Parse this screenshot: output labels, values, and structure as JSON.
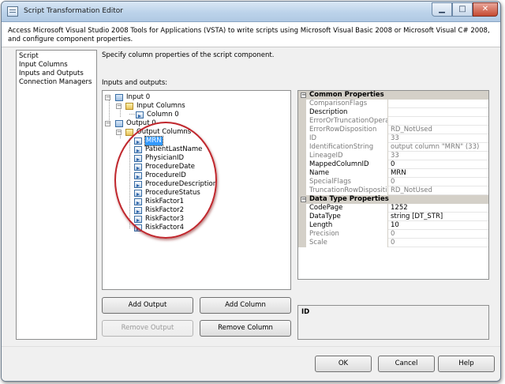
{
  "window": {
    "title": "Script Transformation Editor",
    "min_glyph": "▁",
    "max_glyph": "□",
    "close_glyph": "✕"
  },
  "header": {
    "description": "Access Microsoft Visual Studio 2008 Tools for Applications (VSTA) to write scripts using Microsoft Visual Basic 2008 or Microsoft Visual C# 2008, and configure component properties."
  },
  "nav": {
    "items": [
      "Script",
      "Input Columns",
      "Inputs and Outputs",
      "Connection Managers"
    ]
  },
  "main": {
    "instruction": "Specify column properties of the script component.",
    "io_label": "Inputs and outputs:"
  },
  "tree": {
    "input": "Input 0",
    "input_columns": "Input Columns",
    "input_column_items": [
      "Column 0"
    ],
    "output": "Output 0",
    "output_columns": "Output Columns",
    "output_column_items": [
      "MRN",
      "PatientLastName",
      "PhysicianID",
      "ProcedureDate",
      "ProcedureID",
      "ProcedureDescription",
      "ProcedureStatus",
      "RiskFactor1",
      "RiskFactor2",
      "RiskFactor3",
      "RiskFactor4"
    ],
    "selected": "MRN"
  },
  "buttons": {
    "add_output": "Add Output",
    "add_column": "Add Column",
    "remove_output": "Remove Output",
    "remove_column": "Remove Column",
    "ok": "OK",
    "cancel": "Cancel",
    "help": "Help"
  },
  "properties": {
    "common_title": "Common Properties",
    "common": [
      {
        "name": "ComparisonFlags",
        "value": "",
        "readonly": true
      },
      {
        "name": "Description",
        "value": "",
        "readonly": false
      },
      {
        "name": "ErrorOrTruncationOperatio",
        "value": "",
        "readonly": true
      },
      {
        "name": "ErrorRowDisposition",
        "value": "RD_NotUsed",
        "readonly": true
      },
      {
        "name": "ID",
        "value": "33",
        "readonly": true
      },
      {
        "name": "IdentificationString",
        "value": "output column \"MRN\" (33)",
        "readonly": true
      },
      {
        "name": "LineageID",
        "value": "33",
        "readonly": true
      },
      {
        "name": "MappedColumnID",
        "value": "0",
        "readonly": false
      },
      {
        "name": "Name",
        "value": "MRN",
        "readonly": false
      },
      {
        "name": "SpecialFlags",
        "value": "0",
        "readonly": true
      },
      {
        "name": "TruncationRowDisposition",
        "value": "RD_NotUsed",
        "readonly": true
      }
    ],
    "datatype_title": "Data Type Properties",
    "datatype": [
      {
        "name": "CodePage",
        "value": "1252",
        "readonly": false
      },
      {
        "name": "DataType",
        "value": "string [DT_STR]",
        "readonly": false
      },
      {
        "name": "Length",
        "value": "10",
        "readonly": false
      },
      {
        "name": "Precision",
        "value": "0",
        "readonly": true
      },
      {
        "name": "Scale",
        "value": "0",
        "readonly": true
      }
    ],
    "description_title": "ID"
  },
  "colors": {
    "selection": "#3399ff",
    "highlight_circle": "#c0272d",
    "category_band": "#d4d0c8"
  }
}
